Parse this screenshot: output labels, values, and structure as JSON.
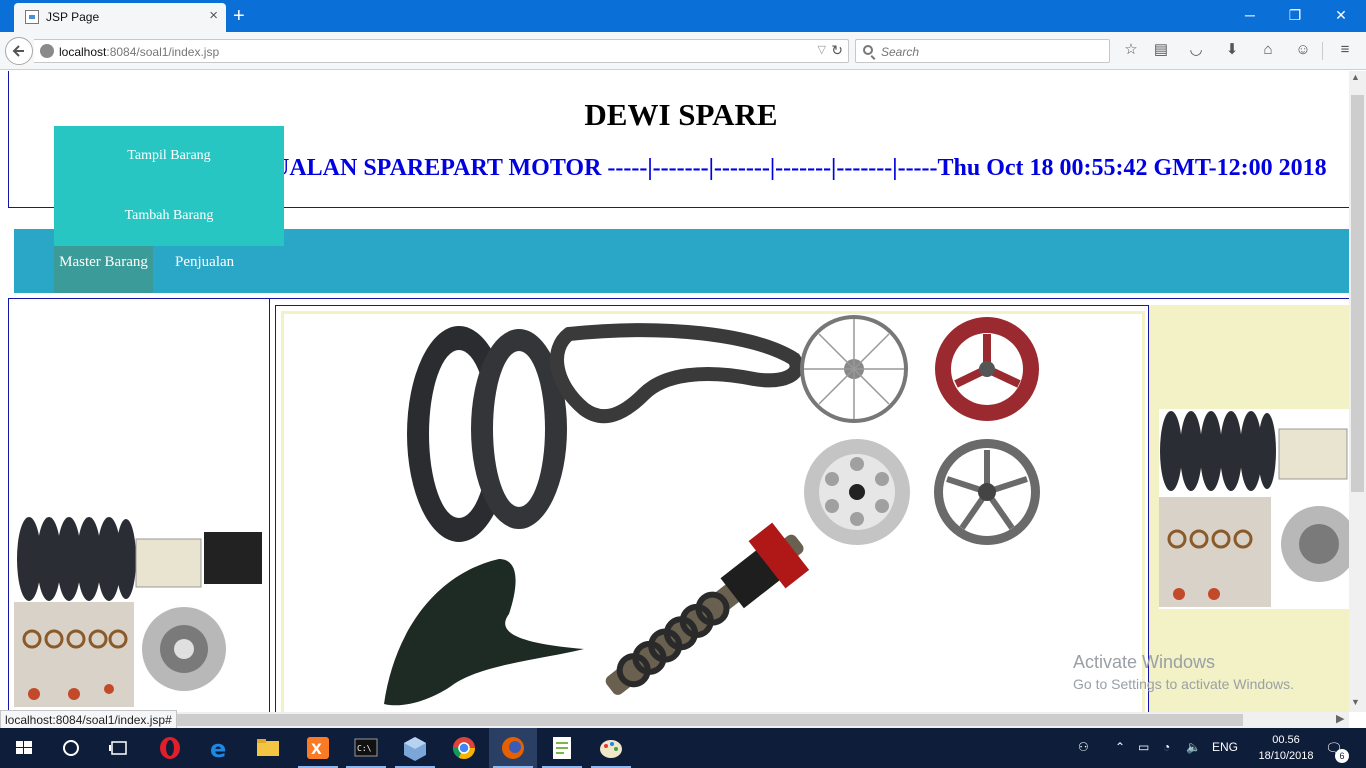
{
  "browser": {
    "tab_title": "JSP Page",
    "tab_close": "×",
    "new_tab": "+",
    "window_controls": {
      "minimize": "─",
      "restore": "❐",
      "close": "✕"
    },
    "url_host": "localhost",
    "url_rest": ":8084/soal1/index.jsp",
    "search_placeholder": "Search",
    "status_url": "localhost:8084/soal1/index.jsp#",
    "toolbar_icons": [
      "bookmark-star-icon",
      "reading-list-icon",
      "pocket-icon",
      "download-icon",
      "home-icon",
      "hello-icon",
      "menu-icon"
    ]
  },
  "page": {
    "title": "DEWI SPARE",
    "marquee": "UALAN SPAREPART MOTOR -----|-------|-------|-------|-------|-----Thu Oct 18 00:55:42 GMT-12:00 2018",
    "menu": {
      "master": "Master Barang",
      "penjualan": "Penjualan",
      "dropdown": [
        "Tampil Barang",
        "Tambah Barang"
      ]
    }
  },
  "watermark": {
    "line1": "Activate Windows",
    "line2": "Go to Settings to activate Windows."
  },
  "taskbar": {
    "apps": [
      "windows-start-icon",
      "cortana-icon",
      "task-view-icon",
      "opera-icon",
      "edge-icon",
      "file-explorer-icon",
      "xampp-icon",
      "terminal-icon",
      "virtualbox-icon",
      "chrome-icon",
      "firefox-icon",
      "notepad-plus-icon",
      "paint-icon"
    ],
    "language": "ENG",
    "time": "00.56",
    "date": "18/10/2018",
    "notifications": "6"
  },
  "colors": {
    "titlebar": "#0a6fd6",
    "menubar": "#2aa6c6",
    "menu_active": "#3a9b98",
    "dropdown": "#27c6c2",
    "marquee_text": "#0000e0",
    "border": "#1515a8",
    "cell_bg": "#f3f1c6"
  }
}
